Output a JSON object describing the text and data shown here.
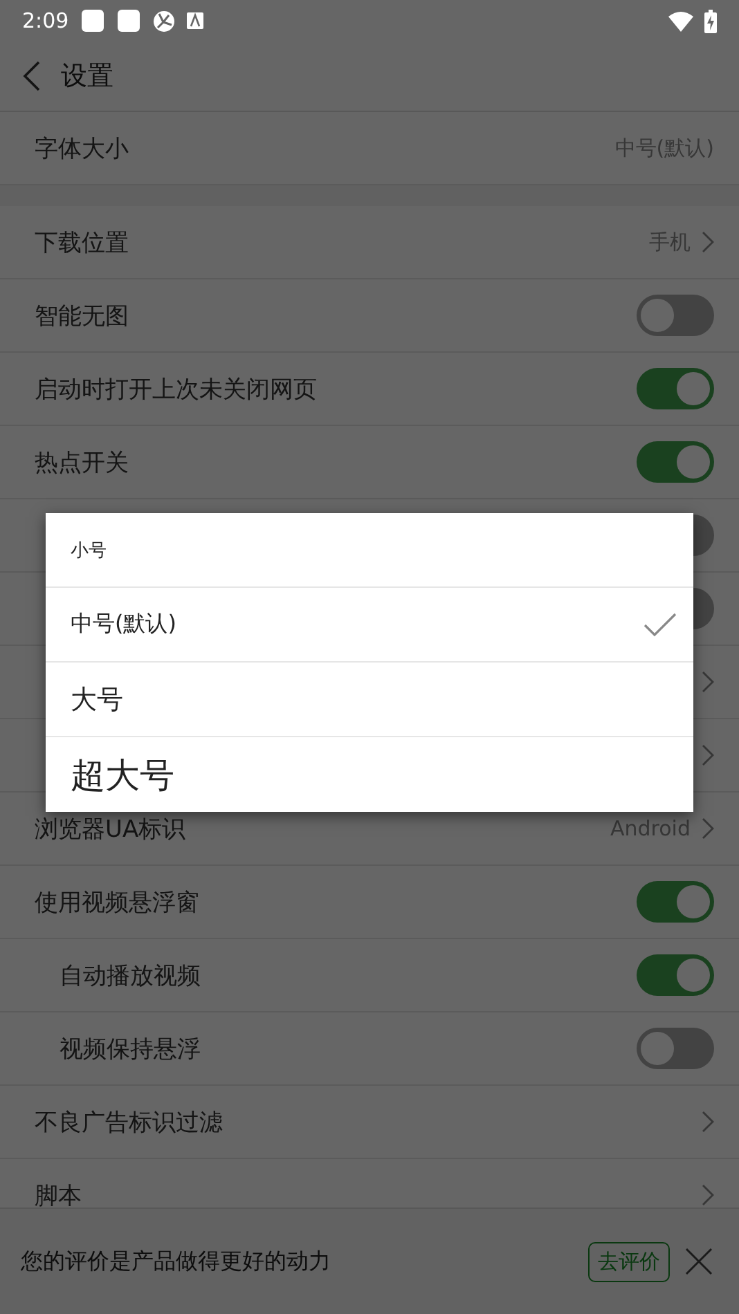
{
  "status_bar": {
    "time": "2:09"
  },
  "header": {
    "title": "设置"
  },
  "sections": [
    {
      "rows": [
        {
          "kind": "value",
          "label": "字体大小",
          "value": "中号(默认)"
        }
      ]
    },
    {
      "rows": [
        {
          "kind": "value_link",
          "label": "下载位置",
          "value": "手机"
        },
        {
          "kind": "toggle",
          "label": "智能无图",
          "on": false
        },
        {
          "kind": "toggle",
          "label": "启动时打开上次未关闭网页",
          "on": true
        },
        {
          "kind": "toggle",
          "label": "热点开关",
          "on": true
        },
        {
          "kind": "toggle",
          "on": false
        },
        {
          "kind": "toggle",
          "on": false
        },
        {
          "kind": "link"
        },
        {
          "kind": "link"
        },
        {
          "kind": "value_link",
          "label": "浏览器UA标识",
          "value": "Android"
        },
        {
          "kind": "toggle",
          "label": "使用视频悬浮窗",
          "on": true,
          "children": [
            {
              "kind": "toggle",
              "label": "自动播放视频",
              "on": true
            },
            {
              "kind": "toggle",
              "label": "视频保持悬浮",
              "on": false
            }
          ]
        },
        {
          "kind": "link",
          "label": "不良广告标识过滤"
        },
        {
          "kind": "link",
          "label": "脚本"
        }
      ]
    }
  ],
  "rating_bar": {
    "text": "您的评价是产品做得更好的动力",
    "button": "去评价"
  },
  "dialog": {
    "options": [
      {
        "label": "小号",
        "selected": false
      },
      {
        "label": "中号(默认)",
        "selected": true
      },
      {
        "label": "大号",
        "selected": false
      },
      {
        "label": "超大号",
        "selected": false
      }
    ]
  }
}
